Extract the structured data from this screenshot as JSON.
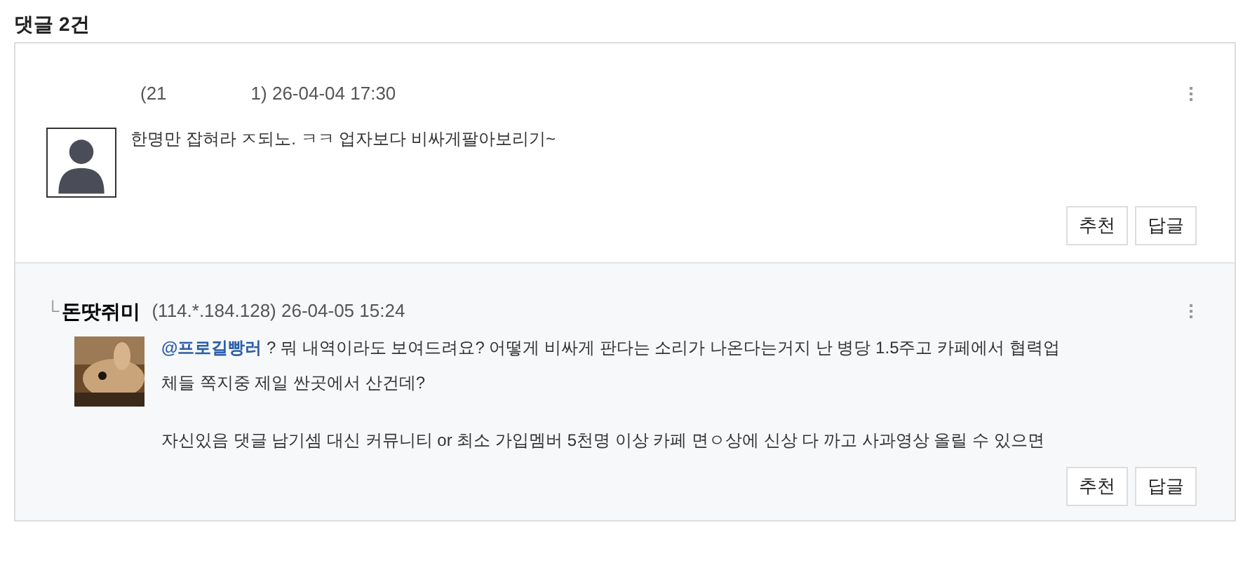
{
  "heading": {
    "label": "댓글",
    "count": "2건"
  },
  "comments": [
    {
      "kind": "comment",
      "ip_start": "(21",
      "ip_end": "1) 26-04-04 17:30",
      "avatar": {
        "kind": "silhouette"
      },
      "paragraphs": [
        {
          "text": "한명만 잡혀라 ㅈ되노. ㅋㅋ 업자보다 비싸게팔아보리기~"
        }
      ],
      "buttons": [
        "추천",
        "답글"
      ]
    },
    {
      "kind": "reply",
      "reply_mark": "└",
      "author": "돈땃쥐미",
      "meta": "(114.*.184.128) 26-04-05 15:24",
      "paragraphs": [
        {
          "mention": "@프로길빵러",
          "text": " ? 뭐 내역이라도 보여드려요? 어떻게 비싸게 판다는 소리가 나온다는거지 난 병당 1.5주고 카페에서 협력업체들 쪽지중 제일 싼곳에서 산건데?"
        },
        {
          "text": "자신있음 댓글 남기셈 대신 커뮤니티 or 최소 가입멤버 5천명 이상 카페 면ㅇ상에 신상 다 까고 사과영상 올릴 수 있으면"
        }
      ],
      "buttons": [
        "추천",
        "답글"
      ]
    }
  ]
}
